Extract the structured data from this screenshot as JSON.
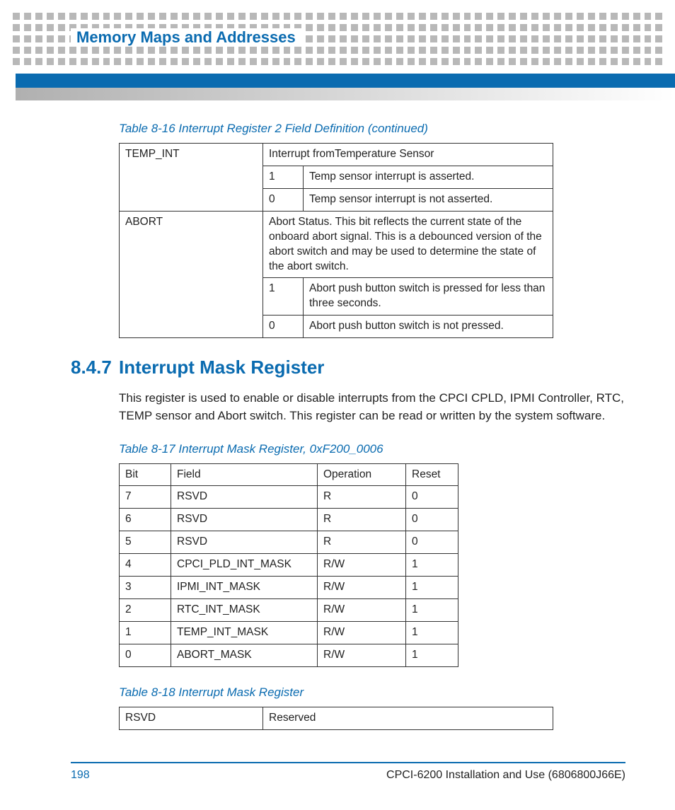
{
  "header": {
    "chapter_title": "Memory Maps and Addresses"
  },
  "captions": {
    "t816": "Table 8-16 Interrupt Register 2 Field Definition (continued)",
    "t817": "Table 8-17 Interrupt Mask Register, 0xF200_0006",
    "t818": "Table 8-18 Interrupt Mask Register"
  },
  "table816": {
    "rows": {
      "r0c0": "TEMP_INT",
      "r0c1": "Interrupt fromTemperature Sensor",
      "r1c0": "1",
      "r1c1": "Temp sensor interrupt is asserted.",
      "r2c0": "0",
      "r2c1": "Temp sensor interrupt is not asserted.",
      "r3c0": "ABORT",
      "r3c1": "Abort Status. This bit reflects the current state of the onboard abort signal.  This is a debounced version of the abort switch and may be used to determine the state of the abort switch.",
      "r4c0": "1",
      "r4c1": "Abort push button switch is pressed for less than three seconds.",
      "r5c0": "0",
      "r5c1": "Abort push button switch is not pressed."
    }
  },
  "section": {
    "number": "8.4.7",
    "title": "Interrupt Mask Register",
    "body": "This register is used to enable or disable interrupts from the CPCI CPLD, IPMI Controller, RTC, TEMP sensor and Abort switch. This register can be read or written by the system software."
  },
  "table817": {
    "headers": {
      "h0": "Bit",
      "h1": "Field",
      "h2": "Operation",
      "h3": "Reset"
    },
    "rows": [
      {
        "c0": "7",
        "c1": "RSVD",
        "c2": "R",
        "c3": "0"
      },
      {
        "c0": "6",
        "c1": "RSVD",
        "c2": "R",
        "c3": "0"
      },
      {
        "c0": "5",
        "c1": "RSVD",
        "c2": "R",
        "c3": "0"
      },
      {
        "c0": "4",
        "c1": "CPCI_PLD_INT_MASK",
        "c2": "R/W",
        "c3": "1"
      },
      {
        "c0": "3",
        "c1": "IPMI_INT_MASK",
        "c2": "R/W",
        "c3": "1"
      },
      {
        "c0": "2",
        "c1": "RTC_INT_MASK",
        "c2": "R/W",
        "c3": "1"
      },
      {
        "c0": "1",
        "c1": "TEMP_INT_MASK",
        "c2": "R/W",
        "c3": "1"
      },
      {
        "c0": "0",
        "c1": "ABORT_MASK",
        "c2": "R/W",
        "c3": "1"
      }
    ]
  },
  "table818": {
    "r0c0": "RSVD",
    "r0c1": "Reserved"
  },
  "footer": {
    "page_number": "198",
    "doc_title": "CPCI-6200 Installation and Use (6806800J66E)"
  }
}
